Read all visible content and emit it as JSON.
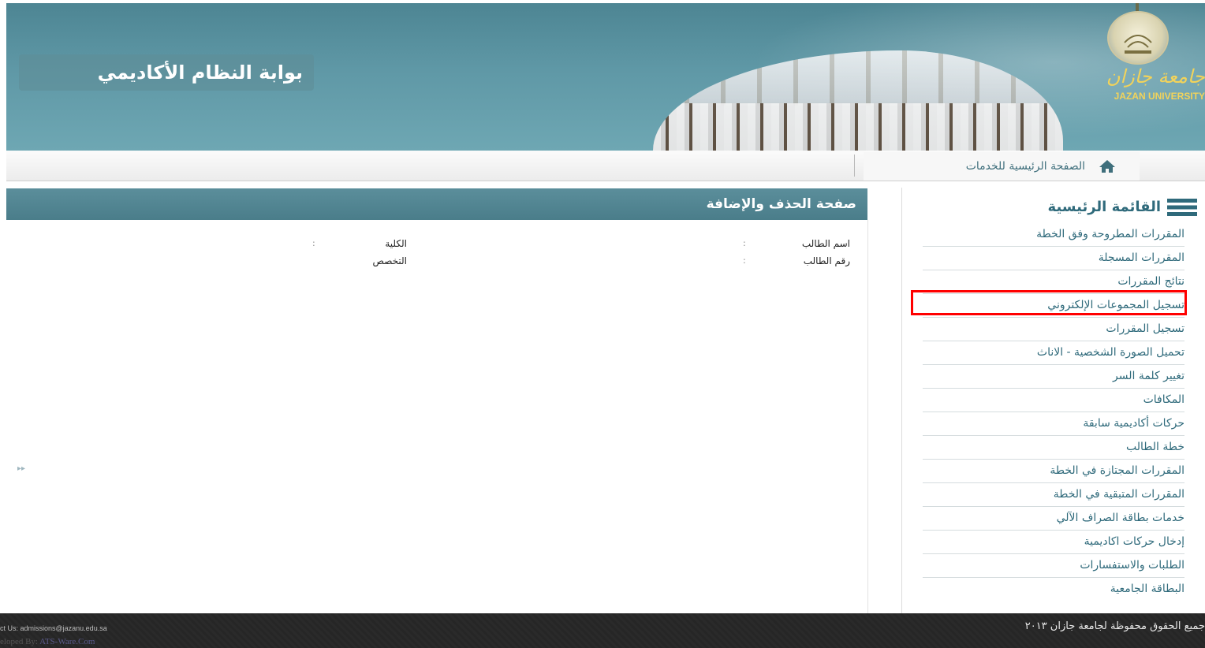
{
  "header": {
    "portal_title": "بوابة النظام الأكاديمي",
    "logo_ar": "جامعة جازان",
    "logo_en": "JAZAN UNIVERSITY"
  },
  "navbar": {
    "home_label": "الصفحة الرئيسية للخدمات",
    "home_icon": "home-icon"
  },
  "sidebar": {
    "title": "القائمة الرئيسية",
    "menu_icon": "hamburger-menu-icon",
    "items": [
      {
        "label": "المقررات المطروحة وفق الخطة"
      },
      {
        "label": "المقررات المسجلة"
      },
      {
        "label": "نتائج المقررات"
      },
      {
        "label": "تسجيل المجموعات الإلكتروني"
      },
      {
        "label": "تسجيل المقررات"
      },
      {
        "label": "تحميل الصورة الشخصية - الاناث"
      },
      {
        "label": "تغيير كلمة السر"
      },
      {
        "label": "المكافات"
      },
      {
        "label": "حركات أكاديمية سابقة"
      },
      {
        "label": "خطة الطالب"
      },
      {
        "label": "المقررات المجتازة في الخطة"
      },
      {
        "label": "المقررات المتبقية في الخطة"
      },
      {
        "label": "خدمات بطاقة الصراف الآلي"
      },
      {
        "label": "إدخال حركات اكاديمية"
      },
      {
        "label": "الطلبات والاستفسارات"
      },
      {
        "label": "البطاقة الجامعية"
      }
    ],
    "highlighted_item": "تسجيل المجموعات الإلكتروني",
    "highlight_color": "#ff0000"
  },
  "main": {
    "title": "صفحة الحذف والإضافة",
    "fields": {
      "student_name_label": "اسم الطالب",
      "student_id_label": "رقم الطالب",
      "college_label": "الكلية",
      "major_label": "التخصص",
      "separator": ":"
    },
    "expand_icon": "double-chevron-right-icon"
  },
  "footer": {
    "rights": "جميع الحقوق محفوظة لجامعة جازان ٢٠١٣",
    "contact": "ct Us: admissions@jazanu.edu.sa",
    "developed_prefix": "eloped By: ",
    "developed_brand": "ATS-Ware.Com"
  },
  "colors": {
    "header_teal": "#5f98a6",
    "link_teal": "#2f6a7b",
    "logo_gold": "#f2d35a",
    "footer_dark": "#2a2a2a"
  }
}
